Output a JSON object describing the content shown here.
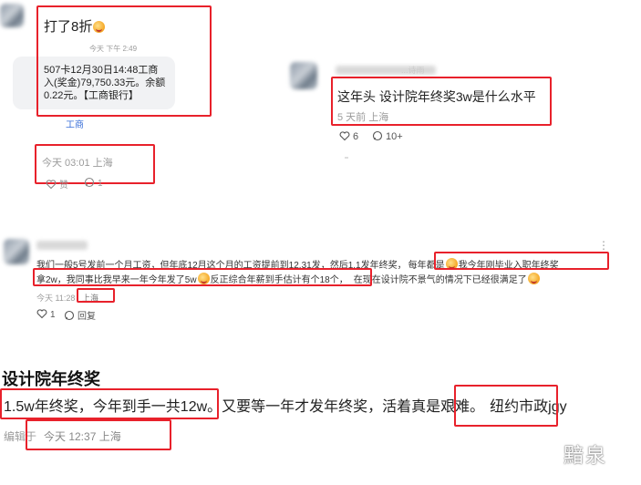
{
  "top_left_card": {
    "dm_text": "打了8折",
    "dm_time": "今天 下午 2:49",
    "bank_message_line1": "507卡12月30日14:48工商",
    "bank_message_line2": "入(奖金)79,750.33元。余额",
    "bank_message_line3": "0.22元。【工商银行】",
    "bank_message_action": "工商",
    "post_time": "今天 03:01 上海",
    "like_label": "赞",
    "comment_count": "1"
  },
  "right_card": {
    "username": "...诗雨",
    "post_text": "这年头 设计院年终奖3w是什么水平",
    "post_meta": "5 天前 上海",
    "like_count": "6",
    "comment_count": "10+"
  },
  "middle_comment": {
    "line1_a": "我们一般5号发前一个月工资，但年底12月这个月的工资提前到12.31发，然后1.1发年终奖，",
    "line1_b": "每年都是",
    "line1_c": "我今年刚毕业入职年终奖",
    "line2_a": "拿2w，",
    "line2_b": "我同事比我早来一年今年发了5w",
    "line2_c": "反正综合年薪到手估计有个18个，",
    "line2_d": "在现在设计院不景气的情况下已经很满足了",
    "time": "今天 11:28",
    "location": "上海",
    "like_count": "1",
    "reply_label": "回复",
    "more_label": "⋮"
  },
  "bottom_post": {
    "title": "设计院年终奖",
    "text_a": "1.5w年终奖，今年到手一共12w。",
    "text_b": "又要等一年才发年终奖，活着真是艰难。",
    "text_c": "纽约市政jgy",
    "edited_label": "编辑于",
    "time_location": "今天 12:37 上海"
  },
  "watermark": "黯泉",
  "colors": {
    "highlight_box": "#e8212b",
    "muted_text": "#9b9b9b",
    "bubble_bg": "#f1f2f4"
  }
}
